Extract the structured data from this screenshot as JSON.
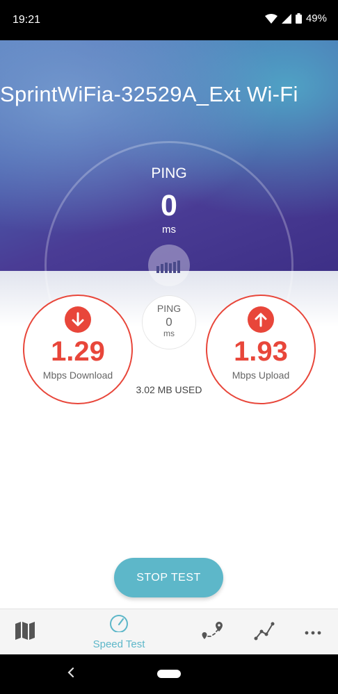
{
  "status_bar": {
    "time": "19:21",
    "battery": "49%"
  },
  "network": {
    "name": "SprintWiFia-32529A_Ext Wi-Fi"
  },
  "gauge": {
    "label": "PING",
    "value": "0",
    "unit": "ms"
  },
  "mini_ping": {
    "label": "PING",
    "value": "0",
    "unit": "ms"
  },
  "download": {
    "value": "1.29",
    "label": "Mbps Download",
    "icon": "arrow-down-icon"
  },
  "upload": {
    "value": "1.93",
    "label": "Mbps Upload",
    "icon": "arrow-up-icon"
  },
  "data_used": "3.02 MB USED",
  "stop_button": "STOP TEST",
  "nav": {
    "items": [
      {
        "icon": "map-icon",
        "label": ""
      },
      {
        "icon": "speedometer-icon",
        "label": "Speed Test"
      },
      {
        "icon": "coverage-icon",
        "label": ""
      },
      {
        "icon": "results-icon",
        "label": ""
      },
      {
        "icon": "more-icon",
        "label": ""
      }
    ]
  },
  "colors": {
    "accent": "#5db7c9",
    "metric": "#e8463a"
  }
}
